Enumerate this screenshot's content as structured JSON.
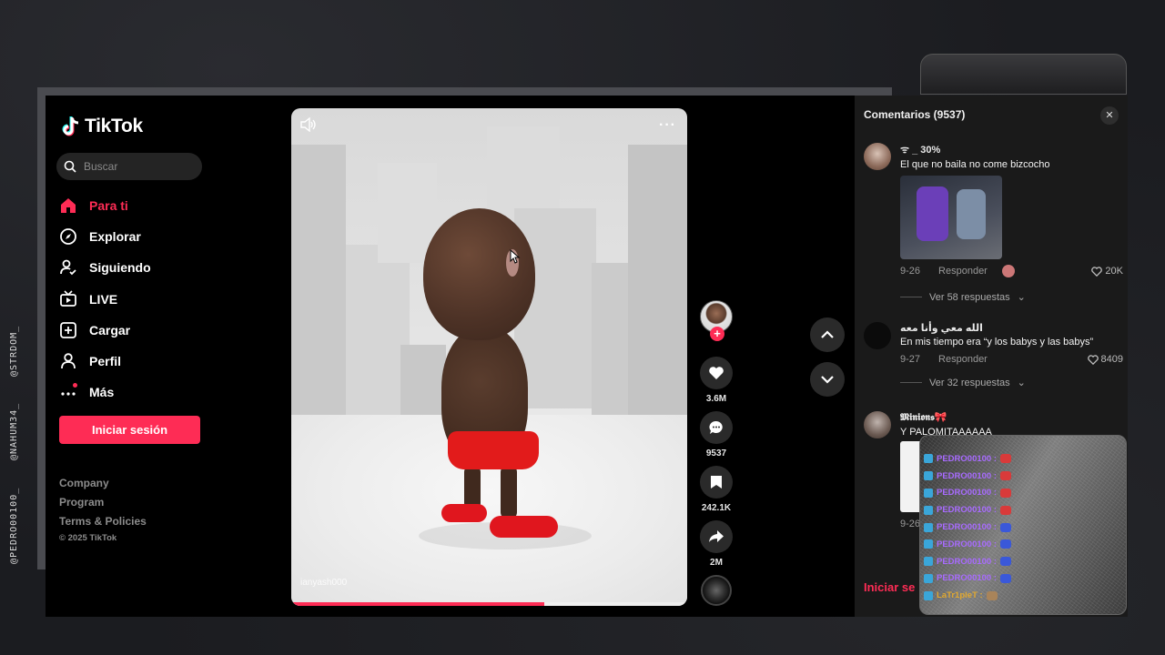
{
  "stream_handles": [
    "@STRDOM_",
    "@NAHUM34_",
    "@PEDRO00100_"
  ],
  "app": {
    "logo": "TikTok",
    "search_placeholder": "Buscar"
  },
  "nav": [
    {
      "label": "Para ti",
      "icon": "home-icon",
      "active": true
    },
    {
      "label": "Explorar",
      "icon": "compass-icon",
      "active": false
    },
    {
      "label": "Siguiendo",
      "icon": "following-icon",
      "active": false
    },
    {
      "label": "LIVE",
      "icon": "live-icon",
      "active": false
    },
    {
      "label": "Cargar",
      "icon": "upload-icon",
      "active": false
    },
    {
      "label": "Perfil",
      "icon": "profile-icon",
      "active": false
    },
    {
      "label": "Más",
      "icon": "more-dots-icon",
      "active": false
    }
  ],
  "login_label": "Iniciar sesión",
  "footer": {
    "links": [
      "Company",
      "Program",
      "Terms & Policies"
    ],
    "copyright": "© 2025 TikTok"
  },
  "video": {
    "watermark": "ianyash000",
    "progress_percent": 64
  },
  "actions": {
    "likes": "3.6M",
    "comments": "9537",
    "saves": "242.1K",
    "shares": "2M"
  },
  "comments_panel": {
    "title": "Comentarios (9537)",
    "reply_label": "Responder",
    "comments": [
      {
        "user": "ᯤ _ 30%",
        "text": "El que no baila no come bizcocho",
        "date": "9-26",
        "likes": "20K",
        "replies": "Ver 58 respuestas"
      },
      {
        "user": "الله معي وأنا معه",
        "text": "En mis tiempo era “y los babys y las babys”",
        "date": "9-27",
        "likes": "8409",
        "replies": "Ver 32 respuestas"
      },
      {
        "user": "𝕸𝖎𝖓𝖎𝖔𝖓𝖘🎀",
        "text": "Y PALOMITAAAAAA",
        "date": "9-26"
      }
    ],
    "bottom_login": "Iniciar se"
  },
  "chat": [
    {
      "name": "PEDRO00100 :",
      "gold": false,
      "emote": "#d93a3a"
    },
    {
      "name": "PEDRO00100 :",
      "gold": false,
      "emote": "#d93a3a"
    },
    {
      "name": "PEDRO00100 :",
      "gold": false,
      "emote": "#d93a3a"
    },
    {
      "name": "PEDRO00100 :",
      "gold": false,
      "emote": "#d93a3a"
    },
    {
      "name": "PEDRO00100 :",
      "gold": false,
      "emote": "#3a58d9"
    },
    {
      "name": "PEDRO00100 :",
      "gold": false,
      "emote": "#3a58d9"
    },
    {
      "name": "PEDRO00100 :",
      "gold": false,
      "emote": "#3a58d9"
    },
    {
      "name": "PEDRO00100 :",
      "gold": false,
      "emote": "#3a58d9"
    },
    {
      "name": "LaTr1pleT :",
      "gold": true,
      "emote": "#a9845a"
    }
  ],
  "colors": {
    "accent": "#fe2c55",
    "panel": "#1a1a1a"
  }
}
